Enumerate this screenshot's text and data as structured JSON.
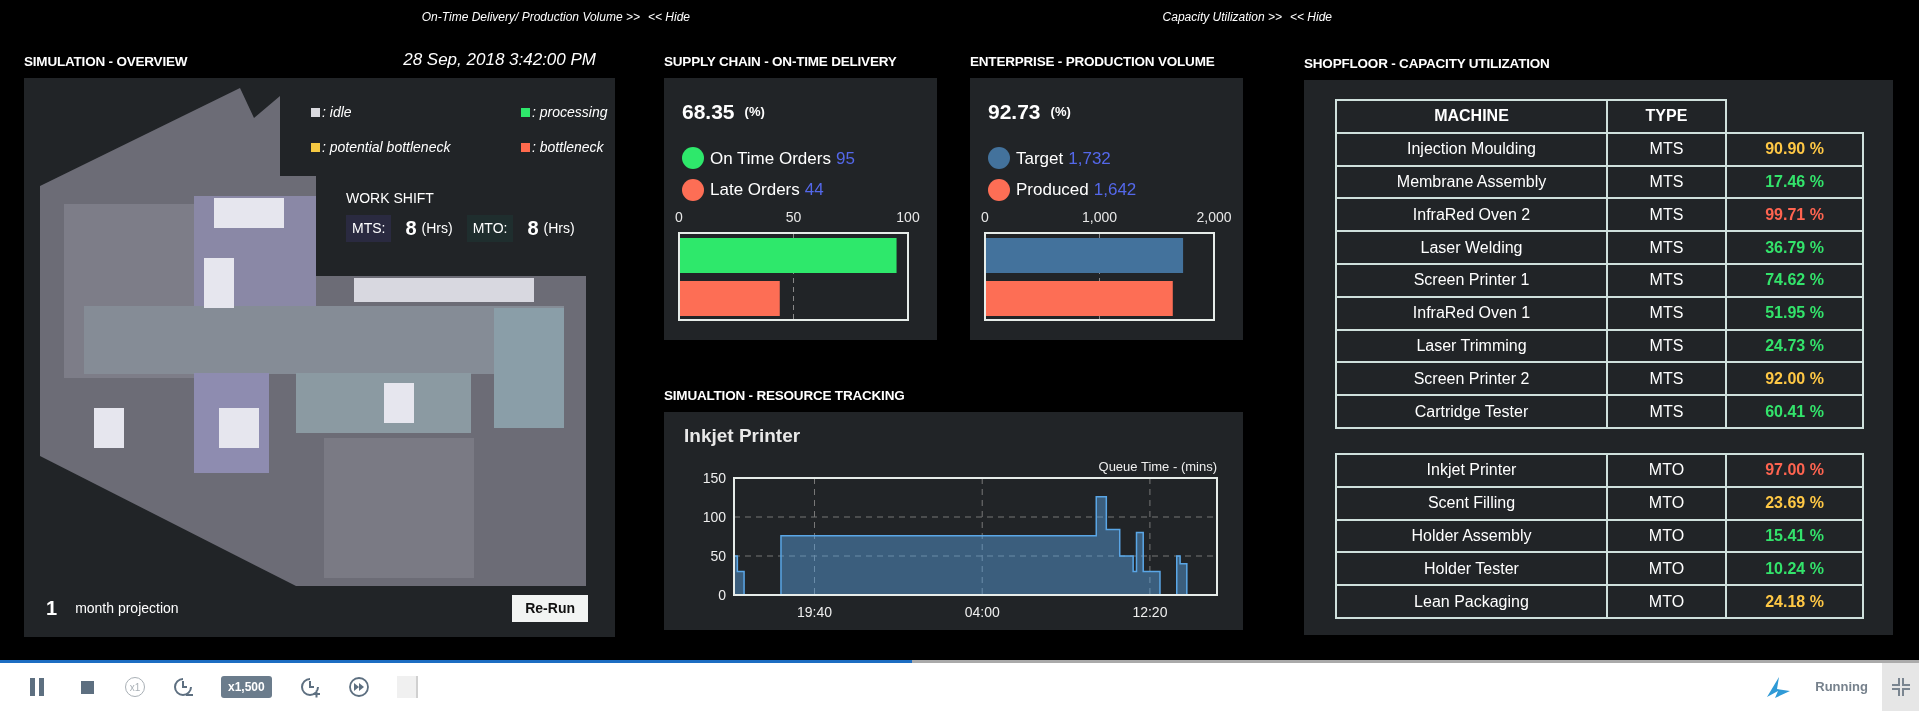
{
  "top_links": [
    {
      "label": "On-Time Delivery/ Production Volume >>"
    },
    {
      "label": "<< Hide"
    },
    {
      "label": "Capacity Utilization >>"
    },
    {
      "label": "<< Hide"
    }
  ],
  "overview": {
    "title": "SIMULATION - OVERVIEW",
    "datetime": "28 Sep, 2018 3:42:00 PM",
    "legend": [
      {
        "label": ": idle",
        "color": "#d9d9de"
      },
      {
        "label": ": processing",
        "color": "#2ee86b"
      },
      {
        "label": ": potential bottleneck",
        "color": "#f5c842"
      },
      {
        "label": ": bottleneck",
        "color": "#ff6a4d"
      }
    ],
    "work_shift": {
      "title": "WORK SHIFT",
      "shifts": [
        {
          "label": "MTS:",
          "value": "8",
          "unit": "(Hrs)",
          "color": "#2a2a40"
        },
        {
          "label": "MTO:",
          "value": "8",
          "unit": "(Hrs)",
          "color": "#1f2e2e"
        }
      ]
    },
    "projection": {
      "value": "1",
      "label": "month projection"
    },
    "rerun_button": "Re-Run"
  },
  "on_time_delivery": {
    "title": "SUPPLY CHAIN - ON-TIME DELIVERY",
    "value": "68.35",
    "unit": "(%)",
    "legend": [
      {
        "label": "On Time Orders",
        "value": "95",
        "color": "#2ee86b"
      },
      {
        "label": "Late Orders",
        "value": "44",
        "color": "#fd6e55"
      }
    ],
    "chart_data": {
      "type": "bar",
      "orientation": "horizontal",
      "xlim": [
        0,
        100
      ],
      "xticks": [
        0,
        50,
        100
      ],
      "series": [
        {
          "color": "#2ee86b",
          "values": [
            95
          ]
        },
        {
          "color": "#fd6e55",
          "values": [
            44
          ]
        }
      ]
    }
  },
  "production_volume": {
    "title": "ENTERPRISE - PRODUCTION VOLUME",
    "value": "92.73",
    "unit": "(%)",
    "legend": [
      {
        "label": "Target",
        "value": "1,732",
        "color": "#43729c"
      },
      {
        "label": "Produced",
        "value": "1,642",
        "color": "#fd6e55"
      }
    ],
    "chart_data": {
      "type": "bar",
      "orientation": "horizontal",
      "xlim": [
        0,
        2000
      ],
      "xticks": [
        0,
        {
          "value": 1000,
          "label": "1,000"
        },
        {
          "value": 2000,
          "label": "2,000"
        }
      ],
      "series": [
        {
          "color": "#43729c",
          "values": [
            1730
          ]
        },
        {
          "color": "#fd6e55",
          "values": [
            1640
          ]
        }
      ]
    }
  },
  "resource_tracking": {
    "title": "SIMUALTION - RESOURCE TRACKING",
    "resource": "Inkjet Printer",
    "chart_data": {
      "type": "area",
      "ylabel": "Queue Time - (mins)",
      "ylim": [
        0,
        150
      ],
      "yticks": [
        0,
        50,
        100,
        150
      ],
      "categories": [
        null,
        null,
        null,
        null,
        null,
        null,
        null,
        null,
        null,
        null,
        null,
        null,
        null,
        null,
        null,
        null,
        null,
        null,
        null,
        null,
        null,
        null,
        null,
        null,
        "19:40",
        null,
        null,
        null,
        null,
        null,
        null,
        null,
        null,
        null,
        null,
        null,
        null,
        null,
        null,
        null,
        null,
        null,
        null,
        null,
        null,
        null,
        null,
        null,
        null,
        null,
        null,
        null,
        null,
        null,
        null,
        null,
        null,
        null,
        null,
        null,
        null,
        null,
        null,
        null,
        null,
        null,
        null,
        null,
        null,
        null,
        null,
        null,
        null,
        null,
        "04:00",
        null,
        null,
        null,
        null,
        null,
        null,
        null,
        null,
        null,
        null,
        null,
        null,
        null,
        null,
        null,
        null,
        null,
        null,
        null,
        null,
        null,
        null,
        null,
        null,
        null,
        null,
        null,
        null,
        null,
        null,
        null,
        null,
        null,
        null,
        null,
        null,
        null,
        null,
        null,
        null,
        null,
        null,
        null,
        null,
        null,
        null,
        null,
        null,
        null,
        "12:20",
        null,
        null,
        null,
        null,
        null,
        null,
        null,
        null,
        null,
        null,
        null,
        null,
        null,
        null,
        null,
        null,
        null,
        null,
        null
      ],
      "series": [
        {
          "color": "#5aa6e6",
          "values": [
            50,
            30,
            30,
            0,
            0,
            0,
            0,
            0,
            0,
            0,
            0,
            0,
            0,
            0,
            76,
            76,
            76,
            76,
            76,
            76,
            76,
            76,
            76,
            76,
            76,
            76,
            76,
            76,
            76,
            76,
            76,
            76,
            76,
            76,
            76,
            76,
            76,
            76,
            76,
            76,
            76,
            76,
            76,
            76,
            76,
            76,
            76,
            76,
            76,
            76,
            76,
            76,
            76,
            76,
            76,
            76,
            76,
            76,
            76,
            76,
            76,
            76,
            76,
            76,
            76,
            76,
            76,
            76,
            76,
            76,
            76,
            76,
            76,
            76,
            76,
            76,
            76,
            76,
            76,
            76,
            76,
            76,
            76,
            76,
            76,
            76,
            76,
            76,
            76,
            76,
            76,
            76,
            76,
            76,
            76,
            76,
            76,
            76,
            76,
            76,
            76,
            76,
            76,
            76,
            76,
            76,
            76,
            76,
            126,
            126,
            126,
            84,
            84,
            84,
            84,
            50,
            50,
            50,
            50,
            30,
            80,
            80,
            30,
            30,
            30,
            30,
            30,
            0,
            0,
            0,
            0,
            0,
            50,
            40,
            40,
            0,
            0,
            0,
            0,
            0,
            0,
            0,
            0,
            0
          ]
        }
      ]
    }
  },
  "capacity": {
    "title": "SHOPFLOOR - CAPACITY UTILIZATION",
    "columns": [
      "MACHINE",
      "TYPE"
    ],
    "groups": [
      {
        "rows": [
          {
            "machine": "Injection Moulding",
            "type": "MTS",
            "utilization": "90.90 %",
            "color": "#ffc845"
          },
          {
            "machine": "Membrane Assembly",
            "type": "MTS",
            "utilization": "17.46 %",
            "color": "#33e36b"
          },
          {
            "machine": "InfraRed Oven 2",
            "type": "MTS",
            "utilization": "99.71 %",
            "color": "#ff6450"
          },
          {
            "machine": "Laser Welding",
            "type": "MTS",
            "utilization": "36.79 %",
            "color": "#33e36b"
          },
          {
            "machine": "Screen Printer 1",
            "type": "MTS",
            "utilization": "74.62 %",
            "color": "#33e36b"
          },
          {
            "machine": "InfraRed Oven 1",
            "type": "MTS",
            "utilization": "51.95 %",
            "color": "#33e36b"
          },
          {
            "machine": "Laser Trimming",
            "type": "MTS",
            "utilization": "24.73 %",
            "color": "#33e36b"
          },
          {
            "machine": "Screen Printer 2",
            "type": "MTS",
            "utilization": "92.00 %",
            "color": "#ffc845"
          },
          {
            "machine": "Cartridge Tester",
            "type": "MTS",
            "utilization": "60.41 %",
            "color": "#33e36b"
          }
        ]
      },
      {
        "rows": [
          {
            "machine": "Inkjet Printer",
            "type": "MTO",
            "utilization": "97.00 %",
            "color": "#ff6450"
          },
          {
            "machine": "Scent Filling",
            "type": "MTO",
            "utilization": "23.69 %",
            "color": "#ffc845"
          },
          {
            "machine": "Holder Assembly",
            "type": "MTO",
            "utilization": "15.41 %",
            "color": "#33e36b"
          },
          {
            "machine": "Holder Tester",
            "type": "MTO",
            "utilization": "10.24 %",
            "color": "#33e36b"
          },
          {
            "machine": "Lean Packaging",
            "type": "MTO",
            "utilization": "24.18 %",
            "color": "#ffc845"
          }
        ]
      }
    ]
  },
  "timeline": {
    "level": 0.475
  },
  "controls": [
    {
      "kind": "pause"
    },
    {
      "kind": "stop"
    },
    {
      "kind": "circle-text",
      "label": "x1"
    },
    {
      "kind": "slower"
    },
    {
      "kind": "badge",
      "label": "x1,500"
    },
    {
      "kind": "faster"
    },
    {
      "kind": "fast-forward"
    },
    {
      "kind": "blank"
    }
  ],
  "status": "Running"
}
